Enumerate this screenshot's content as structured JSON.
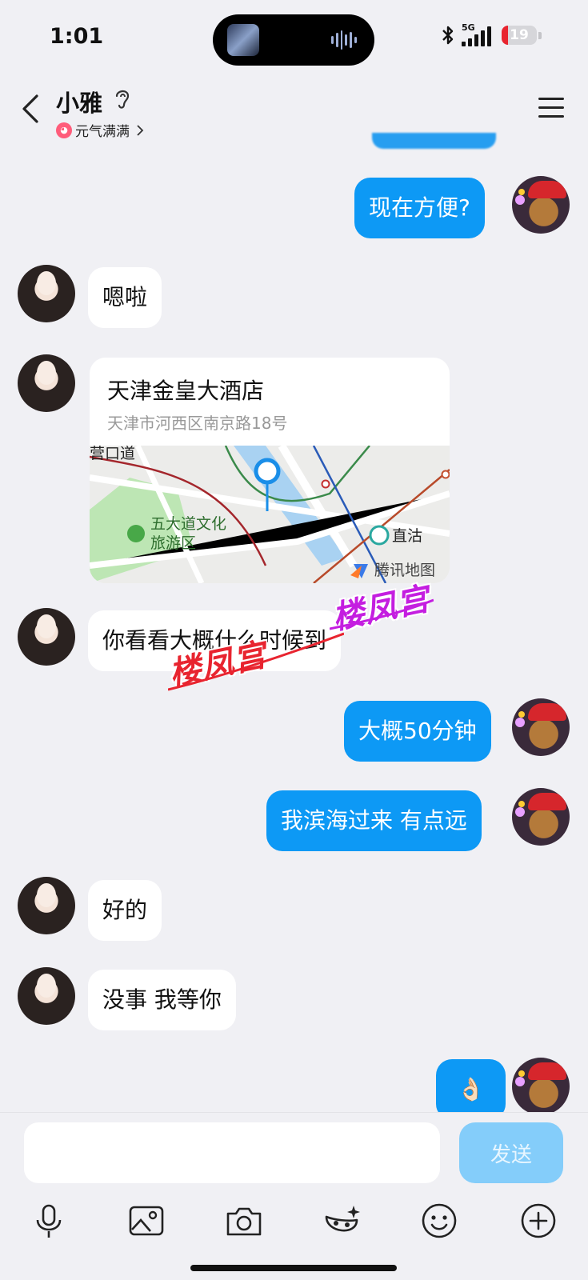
{
  "status_bar": {
    "time": "1:01",
    "network": "5G",
    "battery": "19",
    "battery_level": 0.19
  },
  "header": {
    "contact_name": "小雅",
    "status_text": "元气满满"
  },
  "messages": [
    {
      "side": "out",
      "text": "现在方便?"
    },
    {
      "side": "in",
      "text": "嗯啦"
    },
    {
      "side": "in",
      "type": "location",
      "title": "天津金皇大酒店",
      "address": "天津市河西区南京路18号"
    },
    {
      "side": "in",
      "text": "你看看大概什么时候到"
    },
    {
      "side": "out",
      "text": "大概50分钟"
    },
    {
      "side": "out",
      "text": "我滨海过来 有点远"
    },
    {
      "side": "in",
      "text": "好的"
    },
    {
      "side": "in",
      "text": "没事 我等你"
    },
    {
      "side": "out",
      "text": "👌🏻"
    }
  ],
  "map_labels": {
    "road_1": "营口道",
    "park_1": "五大道文化",
    "park_2": "旅游区",
    "station": "直沽",
    "brand": "腾讯地图"
  },
  "watermarks": {
    "red": "楼凤宫",
    "purple": "楼凤宫"
  },
  "input": {
    "placeholder": "",
    "send_label": "发送"
  },
  "colors": {
    "out_bubble": "#0d99f5",
    "in_bubble": "#ffffff",
    "send_disabled": "#84cdfa",
    "background": "#f0f0f4"
  }
}
